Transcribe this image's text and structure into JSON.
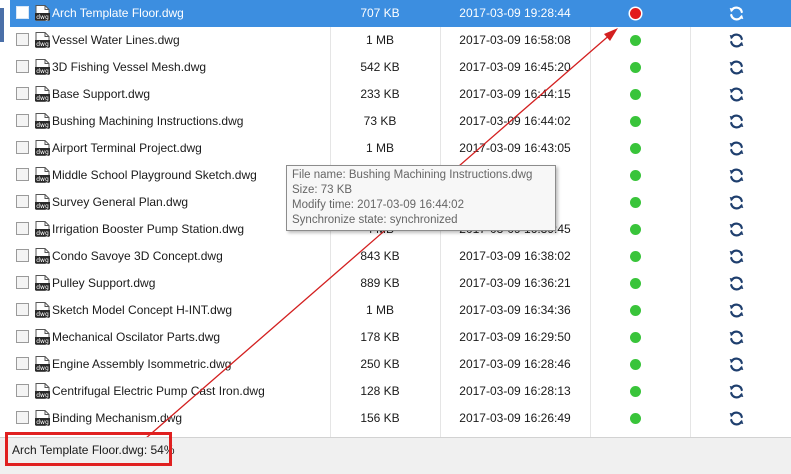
{
  "files": [
    {
      "name": "Arch Template Floor.dwg",
      "size": "707 KB",
      "time": "2017-03-09 19:28:44",
      "status": "red",
      "selected": true
    },
    {
      "name": "Vessel Water Lines.dwg",
      "size": "1 MB",
      "time": "2017-03-09 16:58:08",
      "status": "green"
    },
    {
      "name": "3D Fishing Vessel Mesh.dwg",
      "size": "542 KB",
      "time": "2017-03-09 16:45:20",
      "status": "green"
    },
    {
      "name": "Base Support.dwg",
      "size": "233 KB",
      "time": "2017-03-09 16:44:15",
      "status": "green"
    },
    {
      "name": "Bushing Machining Instructions.dwg",
      "size": "73 KB",
      "time": "2017-03-09 16:44:02",
      "status": "green"
    },
    {
      "name": "Airport Terminal Project.dwg",
      "size": "1 MB",
      "time": "2017-03-09 16:43:05",
      "status": "green"
    },
    {
      "name": "Middle School Playground Sketch.dwg",
      "size": "",
      "time": "",
      "status": "green"
    },
    {
      "name": "Survey General Plan.dwg",
      "size": "",
      "time": "",
      "status": "green"
    },
    {
      "name": "Irrigation Booster Pump Station.dwg",
      "size": "4 MB",
      "time": "2017-03-09 16:39:45",
      "status": "green"
    },
    {
      "name": "Condo Savoye 3D Concept.dwg",
      "size": "843 KB",
      "time": "2017-03-09 16:38:02",
      "status": "green"
    },
    {
      "name": "Pulley Support.dwg",
      "size": "889 KB",
      "time": "2017-03-09 16:36:21",
      "status": "green"
    },
    {
      "name": "Sketch Model Concept H-INT.dwg",
      "size": "1 MB",
      "time": "2017-03-09 16:34:36",
      "status": "green"
    },
    {
      "name": "Mechanical Oscilator Parts.dwg",
      "size": "178 KB",
      "time": "2017-03-09 16:29:50",
      "status": "green"
    },
    {
      "name": "Engine Assembly Isommetric.dwg",
      "size": "250 KB",
      "time": "2017-03-09 16:28:46",
      "status": "green"
    },
    {
      "name": "Centrifugal Electric Pump Cast Iron.dwg",
      "size": "128 KB",
      "time": "2017-03-09 16:28:13",
      "status": "green"
    },
    {
      "name": "Binding Mechanism.dwg",
      "size": "156 KB",
      "time": "2017-03-09 16:26:49",
      "status": "green"
    }
  ],
  "icons": {
    "file_type": "dwg-file-icon",
    "sync": "sync-icon",
    "status_dot": "status-dot-icon"
  },
  "file_icon_text": "dwg",
  "colors": {
    "selected_row": "#3c8ee0",
    "status_ok": "#39c43a",
    "status_syncing": "#e21b1b",
    "sync_icon": "#1f3f6e",
    "highlight": "#e02020"
  },
  "tooltip": {
    "line1": "File name: Bushing Machining Instructions.dwg",
    "line2": "Size: 73 KB",
    "line3": "Modify time: 2017-03-09 16:44:02",
    "line4": "Synchronize state: synchronized"
  },
  "status_bar": {
    "progress_text": "Arch Template Floor.dwg: 54%",
    "progress": 0.54
  }
}
